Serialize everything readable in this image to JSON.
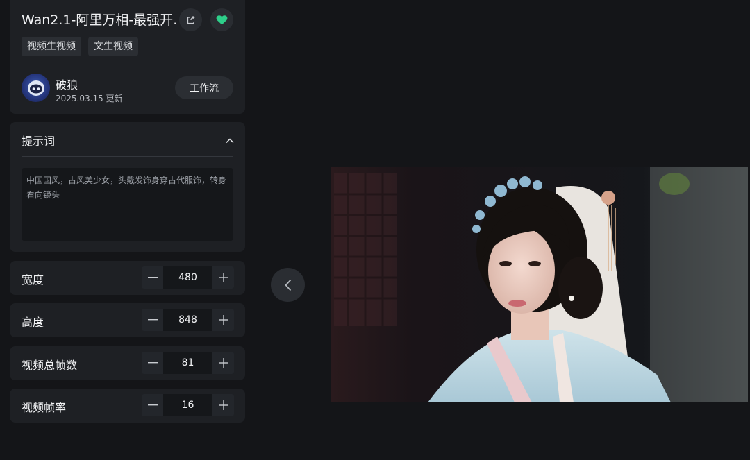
{
  "header": {
    "title": "Wan2.1-阿里万相-最强开…",
    "tags": [
      "视频生视频",
      "文生视频"
    ],
    "author_name": "破狼",
    "author_date": "2025.03.15 更新",
    "workflow_label": "工作流"
  },
  "prompt": {
    "label": "提示词",
    "text": "中国国风，古风美少女，头戴发饰身穿古代服饰，转身看向镜头"
  },
  "params": {
    "width": {
      "label": "宽度",
      "value": "480"
    },
    "height": {
      "label": "高度",
      "value": "848"
    },
    "frames": {
      "label": "视频总帧数",
      "value": "81"
    },
    "fps": {
      "label": "视频帧率",
      "value": "16"
    }
  },
  "icons": {
    "share": "share-icon",
    "favorite": "heart-icon",
    "collapse": "chevron-up-icon",
    "minus": "minus-icon",
    "plus": "plus-icon",
    "prev": "chevron-left-icon"
  },
  "colors": {
    "accent": "#2ecf8a",
    "background": "#141518",
    "card": "#1e2024"
  }
}
